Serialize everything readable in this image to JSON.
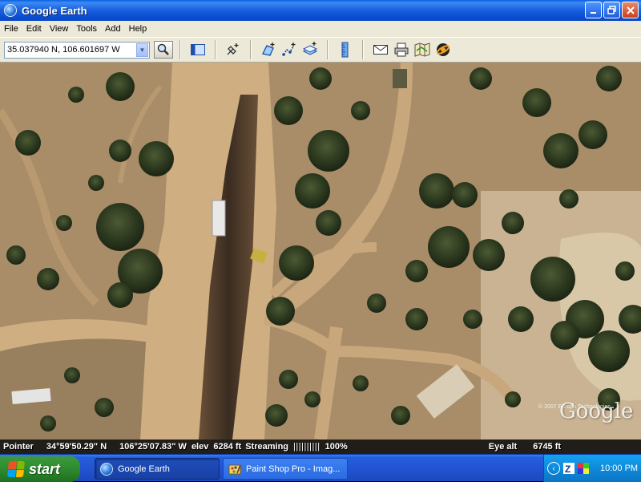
{
  "window": {
    "title": "Google Earth",
    "controls": [
      "minimize",
      "maximize",
      "close"
    ]
  },
  "menu": [
    "File",
    "Edit",
    "View",
    "Tools",
    "Add",
    "Help"
  ],
  "toolbar": {
    "search_value": "35.037940 N, 106.601697 W",
    "icons": [
      "sidebar-icon",
      "placemark-icon",
      "polygon-icon",
      "path-icon",
      "image-overlay-icon",
      "ruler-icon",
      "email-icon",
      "print-icon",
      "maps-icon",
      "sky-icon"
    ]
  },
  "status": {
    "pointer_label": "Pointer",
    "lat": "34°59'50.29\" N",
    "lon": "106°25'07.83\" W",
    "elev_label": "elev",
    "elev_value": "6284 ft",
    "streaming_label": "Streaming",
    "streaming_bar": "||||||||||",
    "streaming_pct": "100%",
    "eye_label": "Eye alt",
    "eye_value": "6745 ft"
  },
  "watermark": {
    "logo": "Google",
    "copyright": "© 2007 Europa Technologies"
  },
  "taskbar": {
    "start_label": "start",
    "tasks": [
      {
        "label": "Google Earth",
        "active": true
      },
      {
        "label": "Paint Shop Pro - Imag...",
        "active": false
      }
    ],
    "clock": "10:00 PM"
  },
  "colors": {
    "title_blue": "#0a4fd1",
    "start_green": "#2e8a2e",
    "dirt": "#c9a77c",
    "brush": "#2f3e22"
  }
}
